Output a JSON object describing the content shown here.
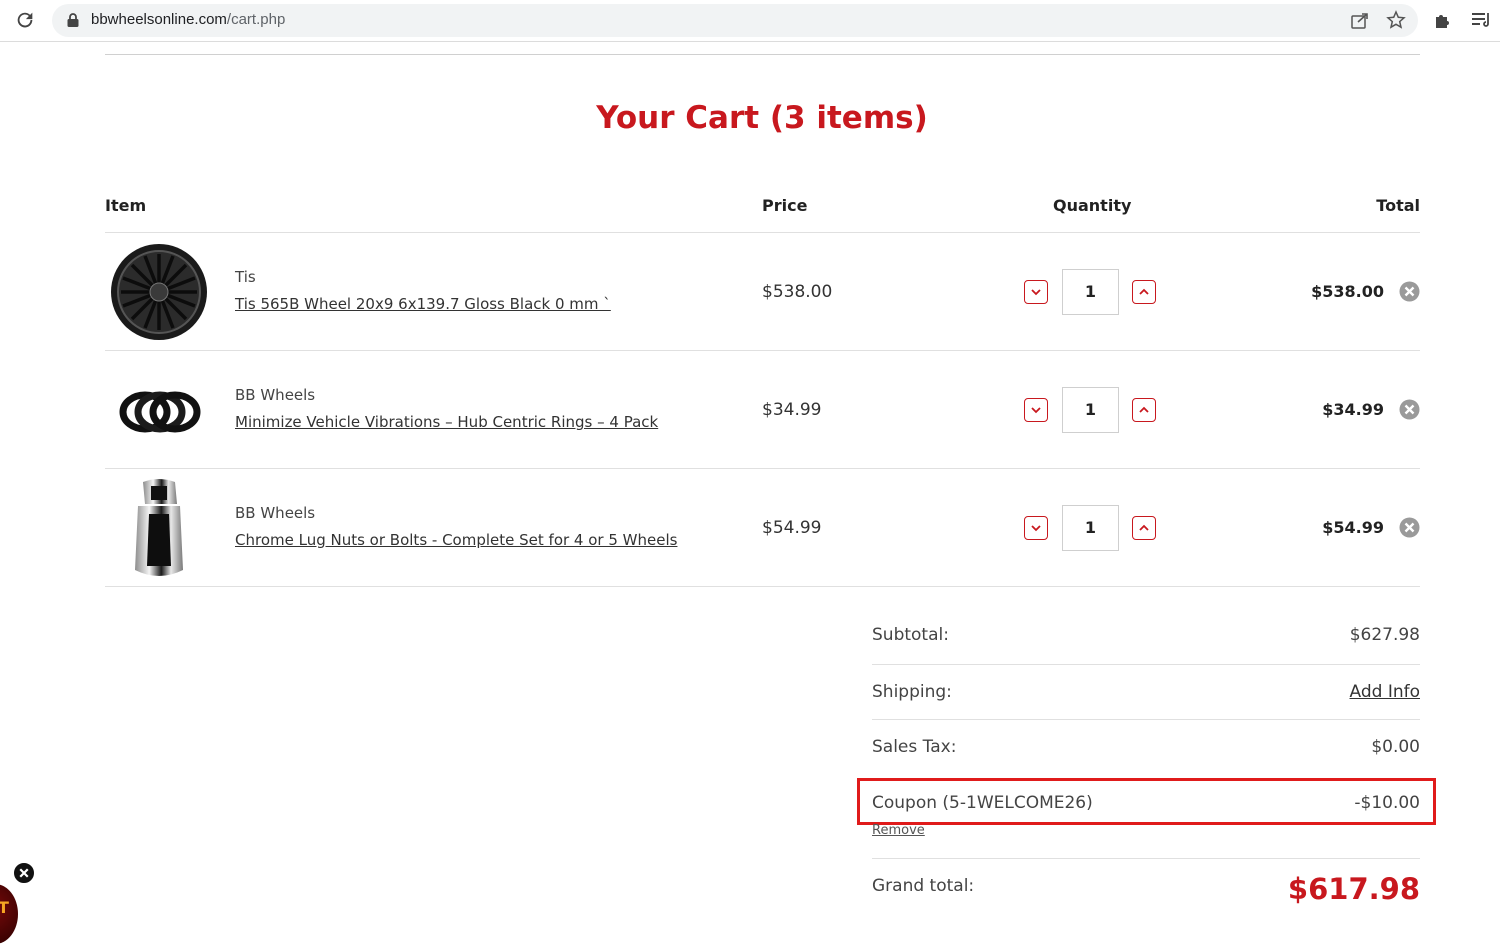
{
  "browser": {
    "url_host": "bbwheelsonline.com",
    "url_path": "/cart.php"
  },
  "page": {
    "title": "Your Cart (3 items)"
  },
  "table": {
    "headers": {
      "item": "Item",
      "price": "Price",
      "quantity": "Quantity",
      "total": "Total"
    },
    "rows": [
      {
        "brand": "Tis",
        "name": "Tis 565B Wheel 20x9 6x139.7 Gloss Black 0 mm `",
        "price": "$538.00",
        "qty": "1",
        "total": "$538.00",
        "image": "black-wheel-image"
      },
      {
        "brand": "BB Wheels",
        "name": "Minimize Vehicle Vibrations – Hub Centric Rings – 4 Pack",
        "price": "$34.99",
        "qty": "1",
        "total": "$34.99",
        "image": "hub-rings-image"
      },
      {
        "brand": "BB Wheels",
        "name": "Chrome Lug Nuts or Bolts - Complete Set for 4 or 5 Wheels",
        "price": "$54.99",
        "qty": "1",
        "total": "$54.99",
        "image": "chrome-lug-nut-image"
      }
    ]
  },
  "summary": {
    "subtotal_label": "Subtotal:",
    "subtotal_value": "$627.98",
    "shipping_label": "Shipping:",
    "shipping_value": "Add Info",
    "tax_label": "Sales Tax:",
    "tax_value": "$0.00",
    "coupon_label": "Coupon (5-1WELCOME26)",
    "coupon_value": "-$10.00",
    "coupon_remove": "Remove",
    "grand_label": "Grand total:",
    "grand_value": "$617.98"
  },
  "colors": {
    "accent": "#c8181e",
    "highlight_box": "#e01b1b"
  },
  "icons": [
    "reload-icon",
    "lock-icon",
    "share-icon",
    "star-icon",
    "extensions-icon",
    "reading-list-icon",
    "quantity-decrease-icon",
    "quantity-increase-icon",
    "remove-item-icon",
    "close-widget-icon"
  ]
}
